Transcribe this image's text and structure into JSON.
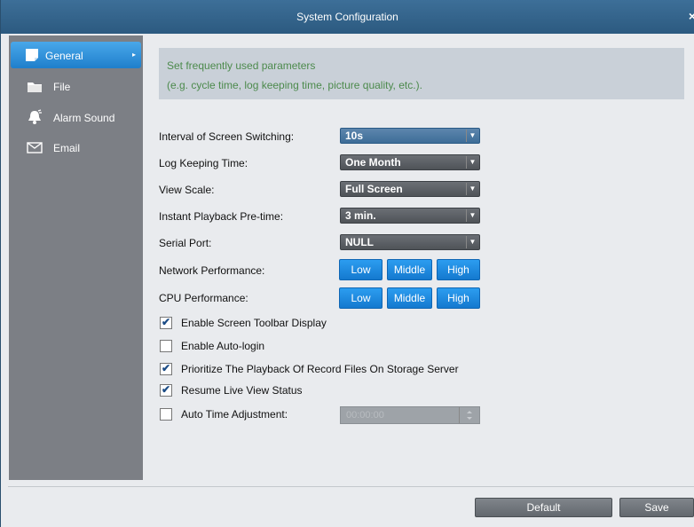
{
  "window": {
    "title": "System Configuration",
    "close_glyph": "×"
  },
  "sidebar": {
    "items": [
      {
        "label": "General",
        "icon": "general-page-icon",
        "active": true
      },
      {
        "label": "File",
        "icon": "folder-icon"
      },
      {
        "label": "Alarm Sound",
        "icon": "bell-icon"
      },
      {
        "label": "Email",
        "icon": "envelope-icon"
      }
    ]
  },
  "general": {
    "description_line1": "Set frequently used parameters",
    "description_line2": "(e.g. cycle time, log keeping time, picture quality, etc.).",
    "interval_label": "Interval of Screen Switching:",
    "interval_value": "10s",
    "log_label": "Log Keeping Time:",
    "log_value": "One Month",
    "view_scale_label": "View Scale:",
    "view_scale_value": "Full Screen",
    "playback_label": "Instant Playback Pre-time:",
    "playback_value": "3 min.",
    "serial_label": "Serial Port:",
    "serial_value": "NULL",
    "network_label": "Network Performance:",
    "cpu_label": "CPU Performance:",
    "perf_options": [
      "Low",
      "Middle",
      "High"
    ],
    "checkboxes": [
      {
        "label": "Enable Screen Toolbar Display",
        "checked": true
      },
      {
        "label": "Enable Auto-login",
        "checked": false
      },
      {
        "label": "Prioritize The Playback Of Record Files On Storage Server",
        "checked": true
      },
      {
        "label": "Resume Live View Status",
        "checked": true
      },
      {
        "label": "Auto Time Adjustment:",
        "checked": false
      }
    ],
    "auto_time_value": "00:00:00",
    "check_glyph": "✔"
  },
  "footer": {
    "default_label": "Default",
    "save_label": "Save"
  },
  "colors": {
    "accent": "#1f7fcb",
    "title_bar": "#2c5a80",
    "sidebar": "#7c7f85"
  }
}
